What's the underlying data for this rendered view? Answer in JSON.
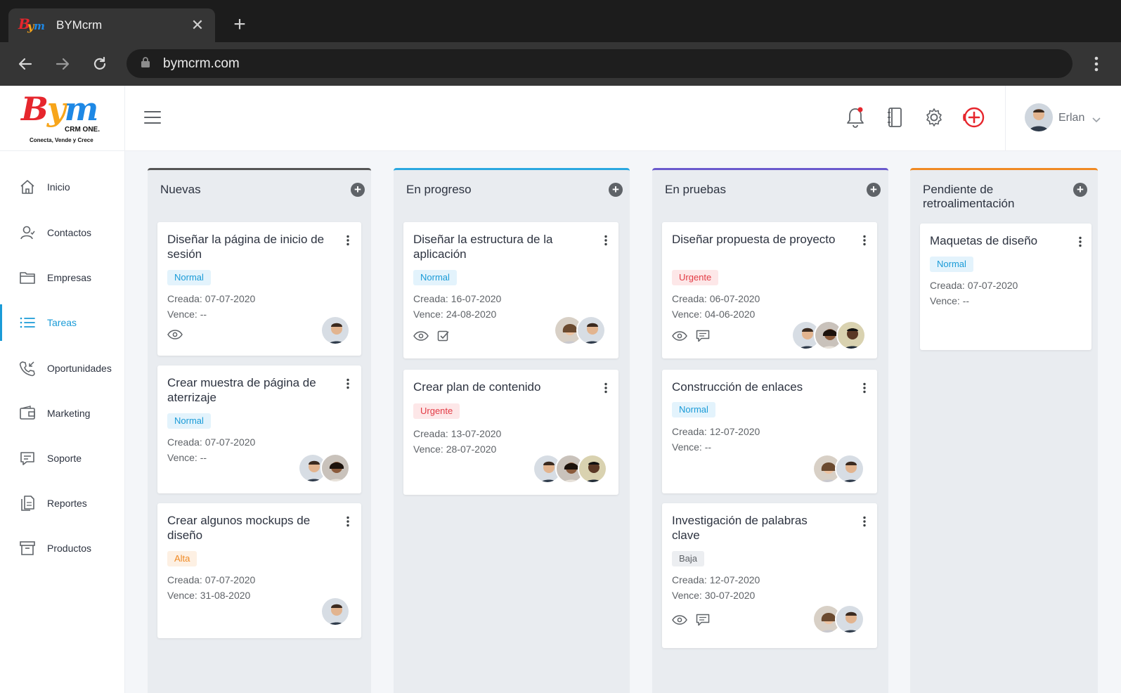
{
  "browser": {
    "tab_title": "BYMcrm",
    "url": "bymcrm.com"
  },
  "brand": {
    "logo_letters": [
      "B",
      "y",
      "m"
    ],
    "logo_sub": "CRM ONE.",
    "tagline": "Conecta, Vende y Crece",
    "colors": {
      "red": "#e6262d",
      "orange": "#f7a51b",
      "blue": "#1e88e5",
      "accent": "#1a9bd7"
    }
  },
  "header": {
    "icons": [
      "bell-icon",
      "notebook-icon",
      "gear-icon",
      "add-circle-icon"
    ],
    "user_name": "Erlan"
  },
  "sidebar": {
    "items": [
      {
        "label": "Inicio",
        "icon": "home-icon"
      },
      {
        "label": "Contactos",
        "icon": "contacts-icon"
      },
      {
        "label": "Empresas",
        "icon": "folder-icon"
      },
      {
        "label": "Tareas",
        "icon": "list-icon",
        "active": true
      },
      {
        "label": "Oportunidades",
        "icon": "phone-icon"
      },
      {
        "label": "Marketing",
        "icon": "wallet-icon"
      },
      {
        "label": "Soporte",
        "icon": "chat-icon"
      },
      {
        "label": "Reportes",
        "icon": "documents-icon"
      },
      {
        "label": "Productos",
        "icon": "archive-icon"
      }
    ]
  },
  "board": {
    "columns": [
      {
        "title": "Nuevas",
        "color": "#555555",
        "cards": [
          {
            "title": "Diseñar la página de inicio de sesión",
            "priority": "Normal",
            "created": "Creada: 07-07-2020",
            "due": "Vence: --"
          },
          {
            "title": "Crear muestra de página de aterrizaje",
            "priority": "Normal",
            "created": "Creada: 07-07-2020",
            "due": "Vence: --"
          },
          {
            "title": "Crear algunos mockups de diseño",
            "priority": "Alta",
            "created": "Creada: 07-07-2020",
            "due": "Vence: 31-08-2020"
          }
        ]
      },
      {
        "title": "En progreso",
        "color": "#2aa8e0",
        "cards": [
          {
            "title": "Diseñar la estructura de la aplicación",
            "priority": "Normal",
            "created": "Creada: 16-07-2020",
            "due": "Vence: 24-08-2020"
          },
          {
            "title": "Crear plan de contenido",
            "priority": "Urgente",
            "created": "Creada: 13-07-2020",
            "due": "Vence: 28-07-2020"
          }
        ]
      },
      {
        "title": "En pruebas",
        "color": "#6a5acd",
        "cards": [
          {
            "title": "Diseñar propuesta de proyecto",
            "priority": "Urgente",
            "created": "Creada: 06-07-2020",
            "due": "Vence: 04-06-2020"
          },
          {
            "title": "Construcción de enlaces",
            "priority": "Normal",
            "created": "Creada: 12-07-2020",
            "due": "Vence: --"
          },
          {
            "title": "Investigación de palabras clave",
            "priority": "Baja",
            "created": "Creada: 12-07-2020",
            "due": "Vence: 30-07-2020"
          }
        ]
      },
      {
        "title": "Pendiente de retroalimentación",
        "color": "#f08a24",
        "cards": [
          {
            "title": "Maquetas de diseño",
            "priority": "Normal",
            "created": "Creada: 07-07-2020",
            "due": "Vence: --"
          }
        ]
      }
    ]
  }
}
